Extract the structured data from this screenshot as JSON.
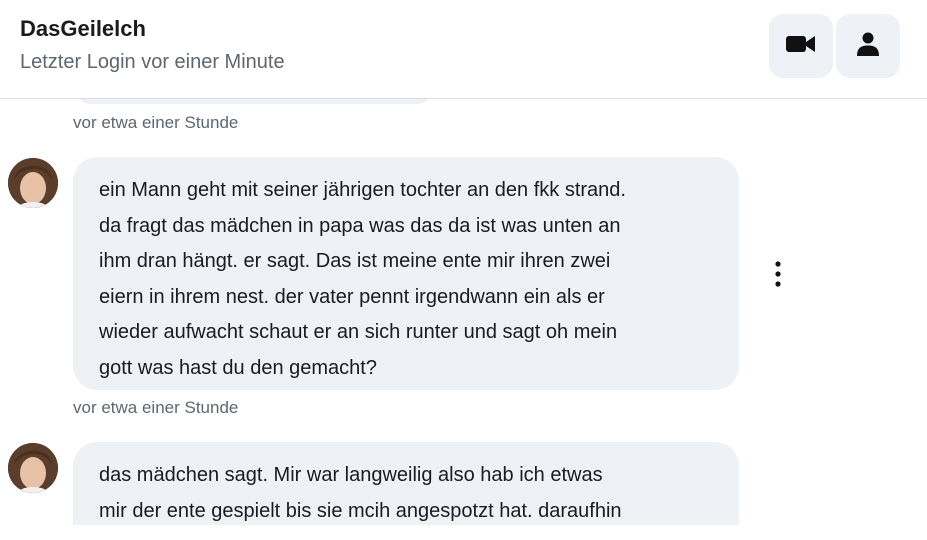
{
  "header": {
    "name": "DasGeilelch",
    "status": "Letzter Login vor einer Minute",
    "video_icon": "video-camera-icon",
    "profile_icon": "person-icon"
  },
  "messages": [
    {
      "timestamp": "vor etwa einer Stunde",
      "lines": [
        "ein Mann geht mit seiner jährigen tochter an den fkk strand.",
        "da fragt das mädchen in papa was das da ist was unten an",
        "ihm dran hängt. er sagt. Das ist meine ente mir ihren zwei",
        "eiern in ihrem nest. der vater pennt irgendwann ein als er",
        "wieder aufwacht schaut er an sich runter und sagt oh mein",
        "gott was hast du den gemacht?"
      ]
    },
    {
      "timestamp": "vor etwa einer Stunde",
      "lines": [
        "das mädchen sagt. Mir war langweilig also hab ich etwas",
        "mir der ente gespielt bis sie mcih angespotzt hat. daraufhin"
      ]
    }
  ],
  "colors": {
    "bubble": "#eef2f7",
    "text": "#1b1b1f",
    "muted": "#5f6670"
  }
}
